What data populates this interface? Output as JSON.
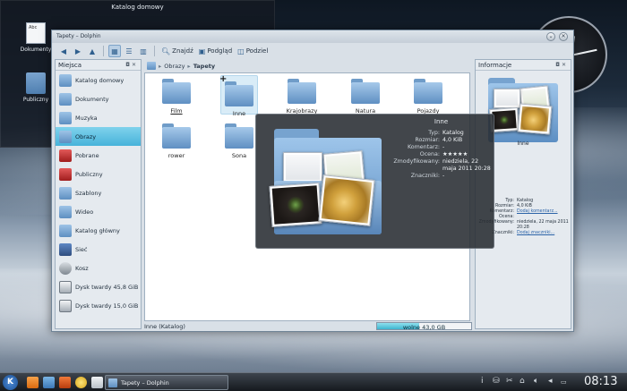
{
  "desktop": {
    "folderview_title": "Katalog domowy",
    "icons": [
      {
        "label": "Dokumenty",
        "doc_text": "Abc"
      },
      {
        "label": "Publiczny"
      }
    ]
  },
  "window": {
    "title": "Tapety – Dolphin",
    "toolbar": {
      "find": "Znajdź",
      "preview": "Podgląd",
      "split": "Podziel"
    },
    "places": {
      "header": "Miejsca",
      "items": [
        {
          "label": "Katalog domowy",
          "icon": "home-folder-icon"
        },
        {
          "label": "Dokumenty",
          "icon": "documents-folder-icon"
        },
        {
          "label": "Muzyka",
          "icon": "music-folder-icon"
        },
        {
          "label": "Obrazy",
          "icon": "pictures-folder-icon"
        },
        {
          "label": "Pobrane",
          "icon": "download-folder-icon"
        },
        {
          "label": "Publiczny",
          "icon": "public-folder-icon"
        },
        {
          "label": "Szablony",
          "icon": "templates-folder-icon"
        },
        {
          "label": "Wideo",
          "icon": "video-folder-icon"
        },
        {
          "label": "Katalog główny",
          "icon": "root-folder-icon"
        },
        {
          "label": "Sieć",
          "icon": "network-icon"
        },
        {
          "label": "Kosz",
          "icon": "trash-icon"
        },
        {
          "label": "Dysk twardy 45,8 GiB",
          "icon": "hard-disk-icon"
        },
        {
          "label": "Dysk twardy 15,0 GiB",
          "icon": "hard-disk-icon"
        }
      ],
      "selected_index": 3
    },
    "breadcrumb": [
      "Obrazy",
      "Tapety"
    ],
    "files": [
      {
        "label": "Film"
      },
      {
        "label": "Inne"
      },
      {
        "label": "Krajobrazy"
      },
      {
        "label": "Natura"
      },
      {
        "label": "Pojazdy"
      },
      {
        "label": "rower"
      },
      {
        "label": "Sona"
      }
    ],
    "info": {
      "header": "Informacje",
      "name": "Inne",
      "rows": [
        {
          "k": "Typ:",
          "v": "Katalog"
        },
        {
          "k": "Rozmiar:",
          "v": "4,0 KiB"
        },
        {
          "k": "Komentarz:",
          "v": "Dodaj komentarz..."
        },
        {
          "k": "Ocena:",
          "v": "★★★★★"
        },
        {
          "k": "Zmodyfikowany:",
          "v": "niedziela, 22 maja 2011 20:28"
        },
        {
          "k": "Znaczniki:",
          "v": "Dodaj znaczniki..."
        }
      ]
    },
    "status": {
      "text": "Inne (Katalog)",
      "free_label": "wolne 43,0 GB",
      "free_fraction": 0.45
    }
  },
  "tooltip": {
    "title": "Inne",
    "rows": [
      {
        "k": "Typ:",
        "v": "Katalog"
      },
      {
        "k": "Rozmiar:",
        "v": "4,0 KiB"
      },
      {
        "k": "Komentarz:",
        "v": "-"
      },
      {
        "k": "Ocena:",
        "v": "★★★★★"
      },
      {
        "k": "Zmodyfikowany:",
        "v": "niedziela, 22 maja 2011 20:28"
      },
      {
        "k": "Znaczniki:",
        "v": "-"
      }
    ]
  },
  "taskbar": {
    "kde_label": "K",
    "task": "Tapety – Dolphin",
    "clock": "08:13"
  }
}
